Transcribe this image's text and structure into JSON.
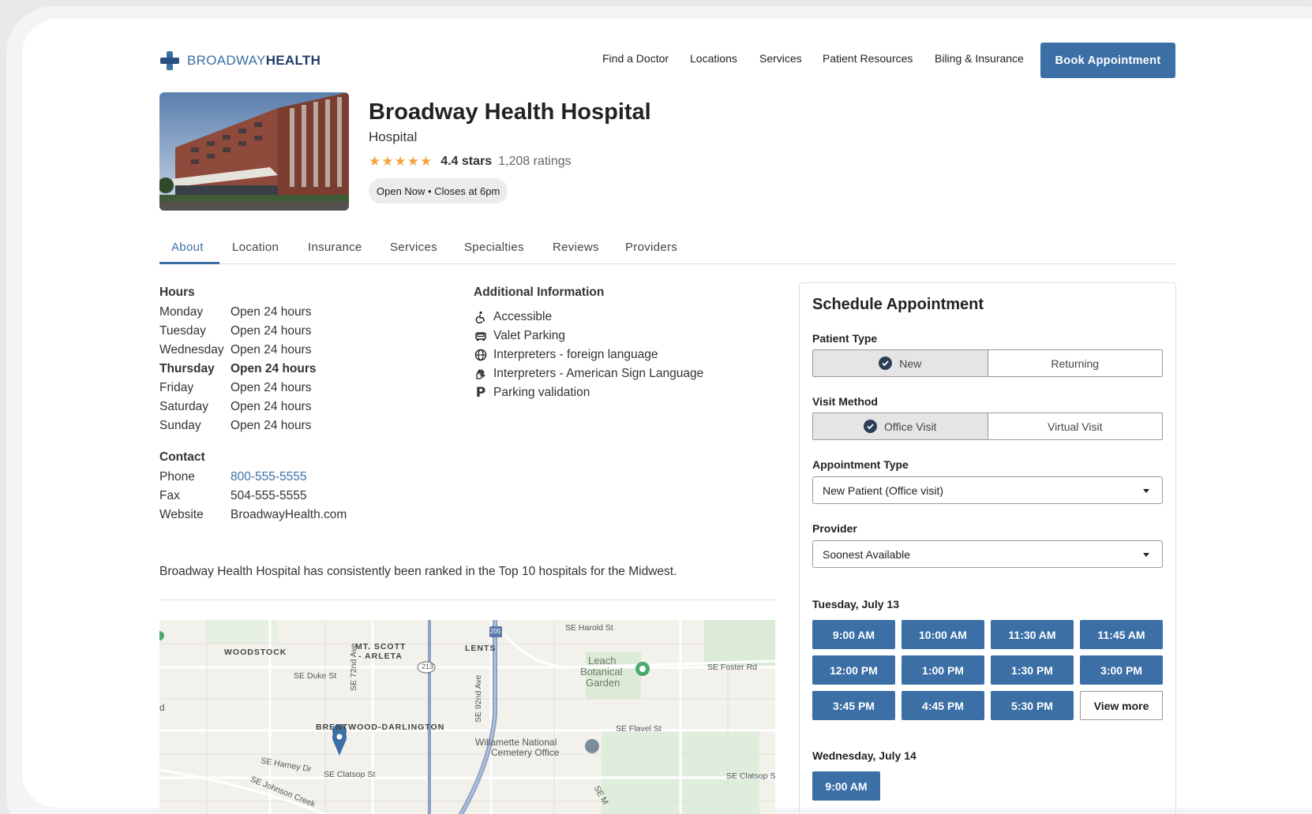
{
  "brand": {
    "part1": "BROADWAY",
    "part2": "HEALTH",
    "accent": "#3b6fa6"
  },
  "nav": [
    "Find a Doctor",
    "Locations",
    "Services",
    "Patient Resources",
    "Biling & Insurance"
  ],
  "book_button": "Book Appointment",
  "hospital": {
    "name": "Broadway Health Hospital",
    "type": "Hospital",
    "stars": "★★★★★",
    "rating_value": "4.4 stars",
    "rating_count": "1,208 ratings",
    "open_status": "Open Now • Closes at 6pm"
  },
  "tabs": [
    "About",
    "Location",
    "Insurance",
    "Services",
    "Specialties",
    "Reviews",
    "Providers"
  ],
  "hours": {
    "title": "Hours",
    "rows": [
      {
        "day": "Monday",
        "value": "Open 24 hours"
      },
      {
        "day": "Tuesday",
        "value": "Open 24 hours"
      },
      {
        "day": "Wednesday",
        "value": "Open 24 hours"
      },
      {
        "day": "Thursday",
        "value": "Open 24 hours"
      },
      {
        "day": "Friday",
        "value": "Open 24 hours"
      },
      {
        "day": "Saturday",
        "value": "Open 24 hours"
      },
      {
        "day": "Sunday",
        "value": "Open 24 hours"
      }
    ]
  },
  "contact": {
    "title": "Contact",
    "rows": [
      {
        "label": "Phone",
        "value": "800-555-5555"
      },
      {
        "label": "Fax",
        "value": "504-555-5555"
      },
      {
        "label": "Website",
        "value": "BroadwayHealth.com"
      }
    ]
  },
  "additional": {
    "title": "Additional Information",
    "items": [
      {
        "icon": "accessible-icon",
        "label": "Accessible"
      },
      {
        "icon": "car-icon",
        "label": "Valet Parking"
      },
      {
        "icon": "globe-icon",
        "label": "Interpreters - foreign language"
      },
      {
        "icon": "sign-language-icon",
        "label": "Interpreters - American Sign Language"
      },
      {
        "icon": "parking-icon",
        "label": "Parking validation"
      }
    ]
  },
  "description": "Broadway Health Hospital has consistently been ranked in the Top 10 hospitals for the Midwest.",
  "map": {
    "labels": {
      "woodstock": "WOODSTOCK",
      "mt_scott": "MT. SCOTT",
      "arleta": "- ARLETA",
      "lents": "LENTS",
      "harold": "SE Harold St",
      "leach": "Leach",
      "botanical": "Botanical",
      "garden": "Garden",
      "foster": "SE Foster Rd",
      "duke": "SE Duke St",
      "ave72": "SE 72nd Ave",
      "ave92": "SE 92nd Ave",
      "brentwood": "BRENTWOOD-DARLINGTON",
      "flavel": "SE Flavel St",
      "willamette": "Willamette National",
      "cemetery": "Cemetery Office",
      "harney": "SE Harney Dr",
      "clatsop": "SE Clatsop St",
      "clatsop2": "SE Clatsop S",
      "johnson": "SE Johnson Creek",
      "hwy213": "213",
      "hwy205": "205",
      "d": "d",
      "sem": "SE M"
    }
  },
  "schedule": {
    "title": "Schedule Appointment",
    "patient_type_label": "Patient Type",
    "patient_type_options": [
      "New",
      "Returning"
    ],
    "patient_type_selected": "New",
    "visit_method_label": "Visit Method",
    "visit_method_options": [
      "Office Visit",
      "Virtual Visit"
    ],
    "visit_method_selected": "Office Visit",
    "appointment_type_label": "Appointment Type",
    "appointment_type_value": "New Patient (Office visit)",
    "provider_label": "Provider",
    "provider_value": "Soonest Available",
    "days": [
      {
        "label": "Tuesday, July 13",
        "slots": [
          "9:00 AM",
          "10:00 AM",
          "11:30 AM",
          "11:45 AM",
          "12:00 PM",
          "1:00 PM",
          "1:30 PM",
          "3:00 PM",
          "3:45 PM",
          "4:45 PM",
          "5:30 PM"
        ],
        "more": "View more"
      },
      {
        "label": "Wednesday, July 14",
        "slots": [
          "9:00 AM"
        ]
      }
    ]
  }
}
